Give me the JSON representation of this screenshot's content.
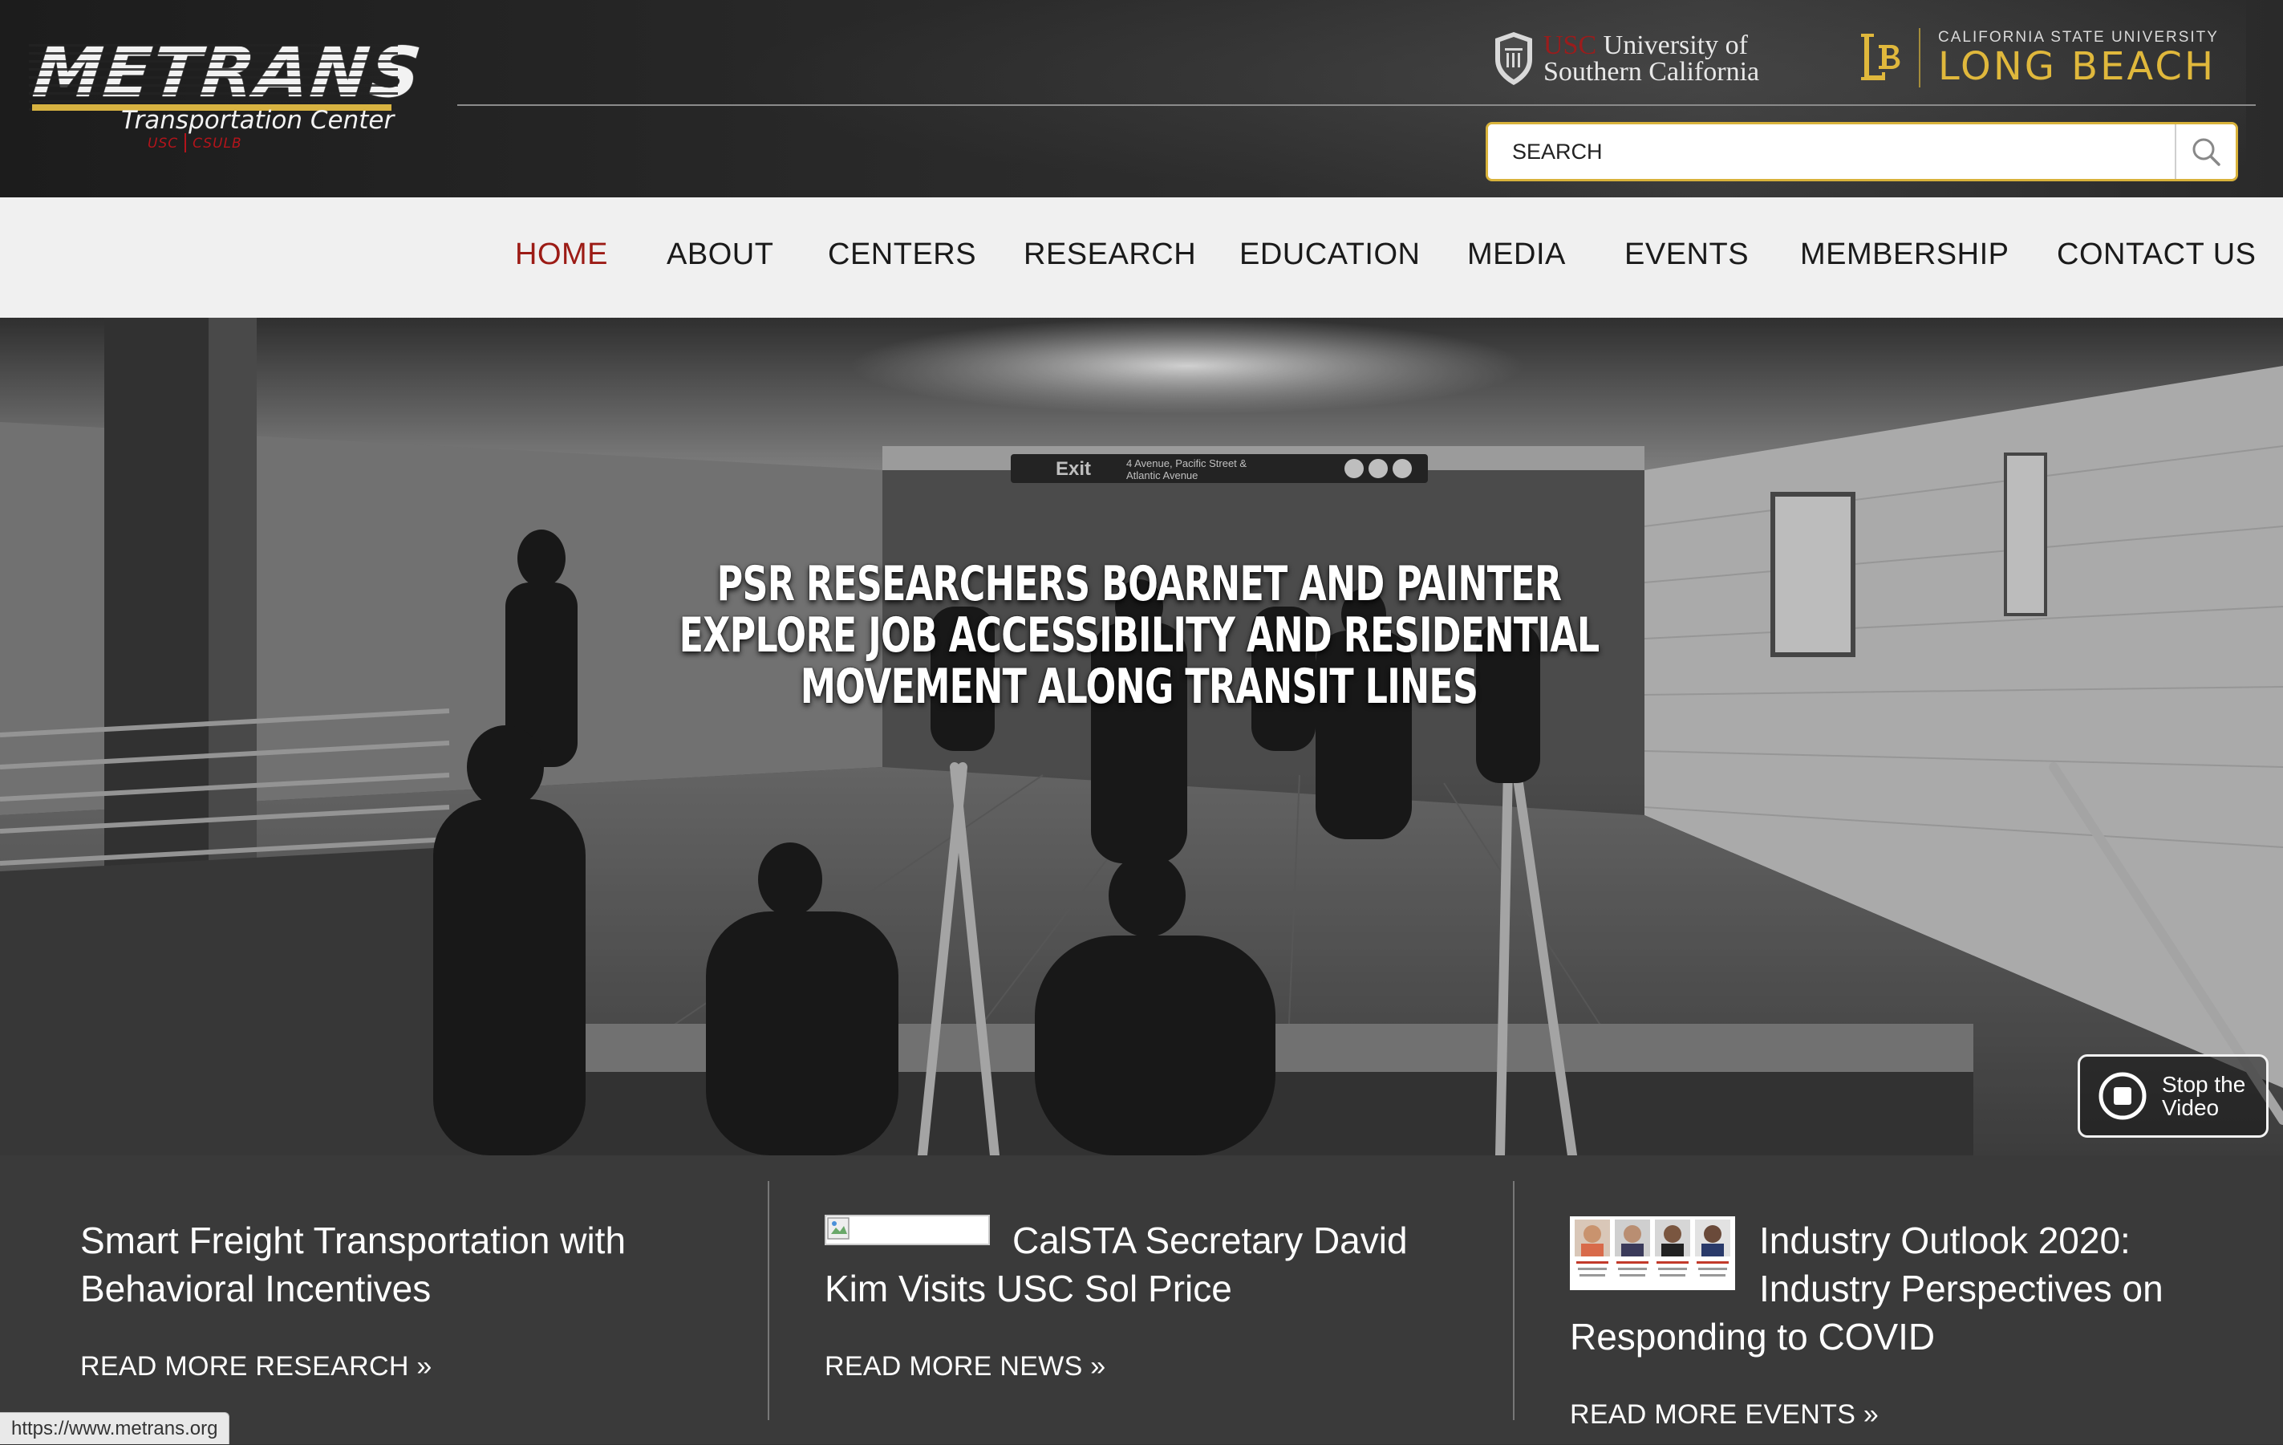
{
  "logo": {
    "wordmark": "METRANS",
    "subtitle": "Transportation Center",
    "tag_left": "USC",
    "tag_right": "CSULB"
  },
  "partners": {
    "usc": {
      "prefix": "USC",
      "line1": "University of",
      "line2": "Southern California"
    },
    "lb": {
      "small": "CALIFORNIA STATE UNIVERSITY",
      "big": "LONG BEACH"
    }
  },
  "search": {
    "placeholder": "SEARCH"
  },
  "nav": {
    "items": [
      {
        "label": "HOME",
        "active": true
      },
      {
        "label": "ABOUT"
      },
      {
        "label": "CENTERS"
      },
      {
        "label": "RESEARCH"
      },
      {
        "label": "EDUCATION"
      },
      {
        "label": "MEDIA"
      },
      {
        "label": "EVENTS"
      },
      {
        "label": "MEMBERSHIP"
      },
      {
        "label": "CONTACT US"
      }
    ]
  },
  "hero": {
    "title": "PSR RESEARCHERS BOARNET AND PAINTER EXPLORE JOB ACCESSIBILITY AND RESIDENTIAL MOVEMENT ALONG TRANSIT LINES",
    "stop_video_label": "Stop the Video",
    "signage": {
      "exit": "Exit",
      "line1": "4 Avenue, Pacific Street &",
      "line2": "Atlantic Avenue"
    }
  },
  "features": [
    {
      "title": "Smart Freight Transportation with Behavioral Incentives",
      "more": "READ MORE RESEARCH »"
    },
    {
      "title": "CalSTA Secretary David Kim Visits USC Sol Price",
      "more": "READ MORE NEWS »"
    },
    {
      "title": "Industry Outlook 2020: Industry Perspectives on Responding to COVID",
      "more": "READ MORE EVENTS »"
    }
  ],
  "status_bar": {
    "url": "https://www.metrans.org"
  },
  "colors": {
    "accent_gold": "#d9b33b",
    "active_red": "#9c1b15",
    "nav_bg": "#f0f0f0",
    "footer_bg": "#3a3a3a"
  }
}
